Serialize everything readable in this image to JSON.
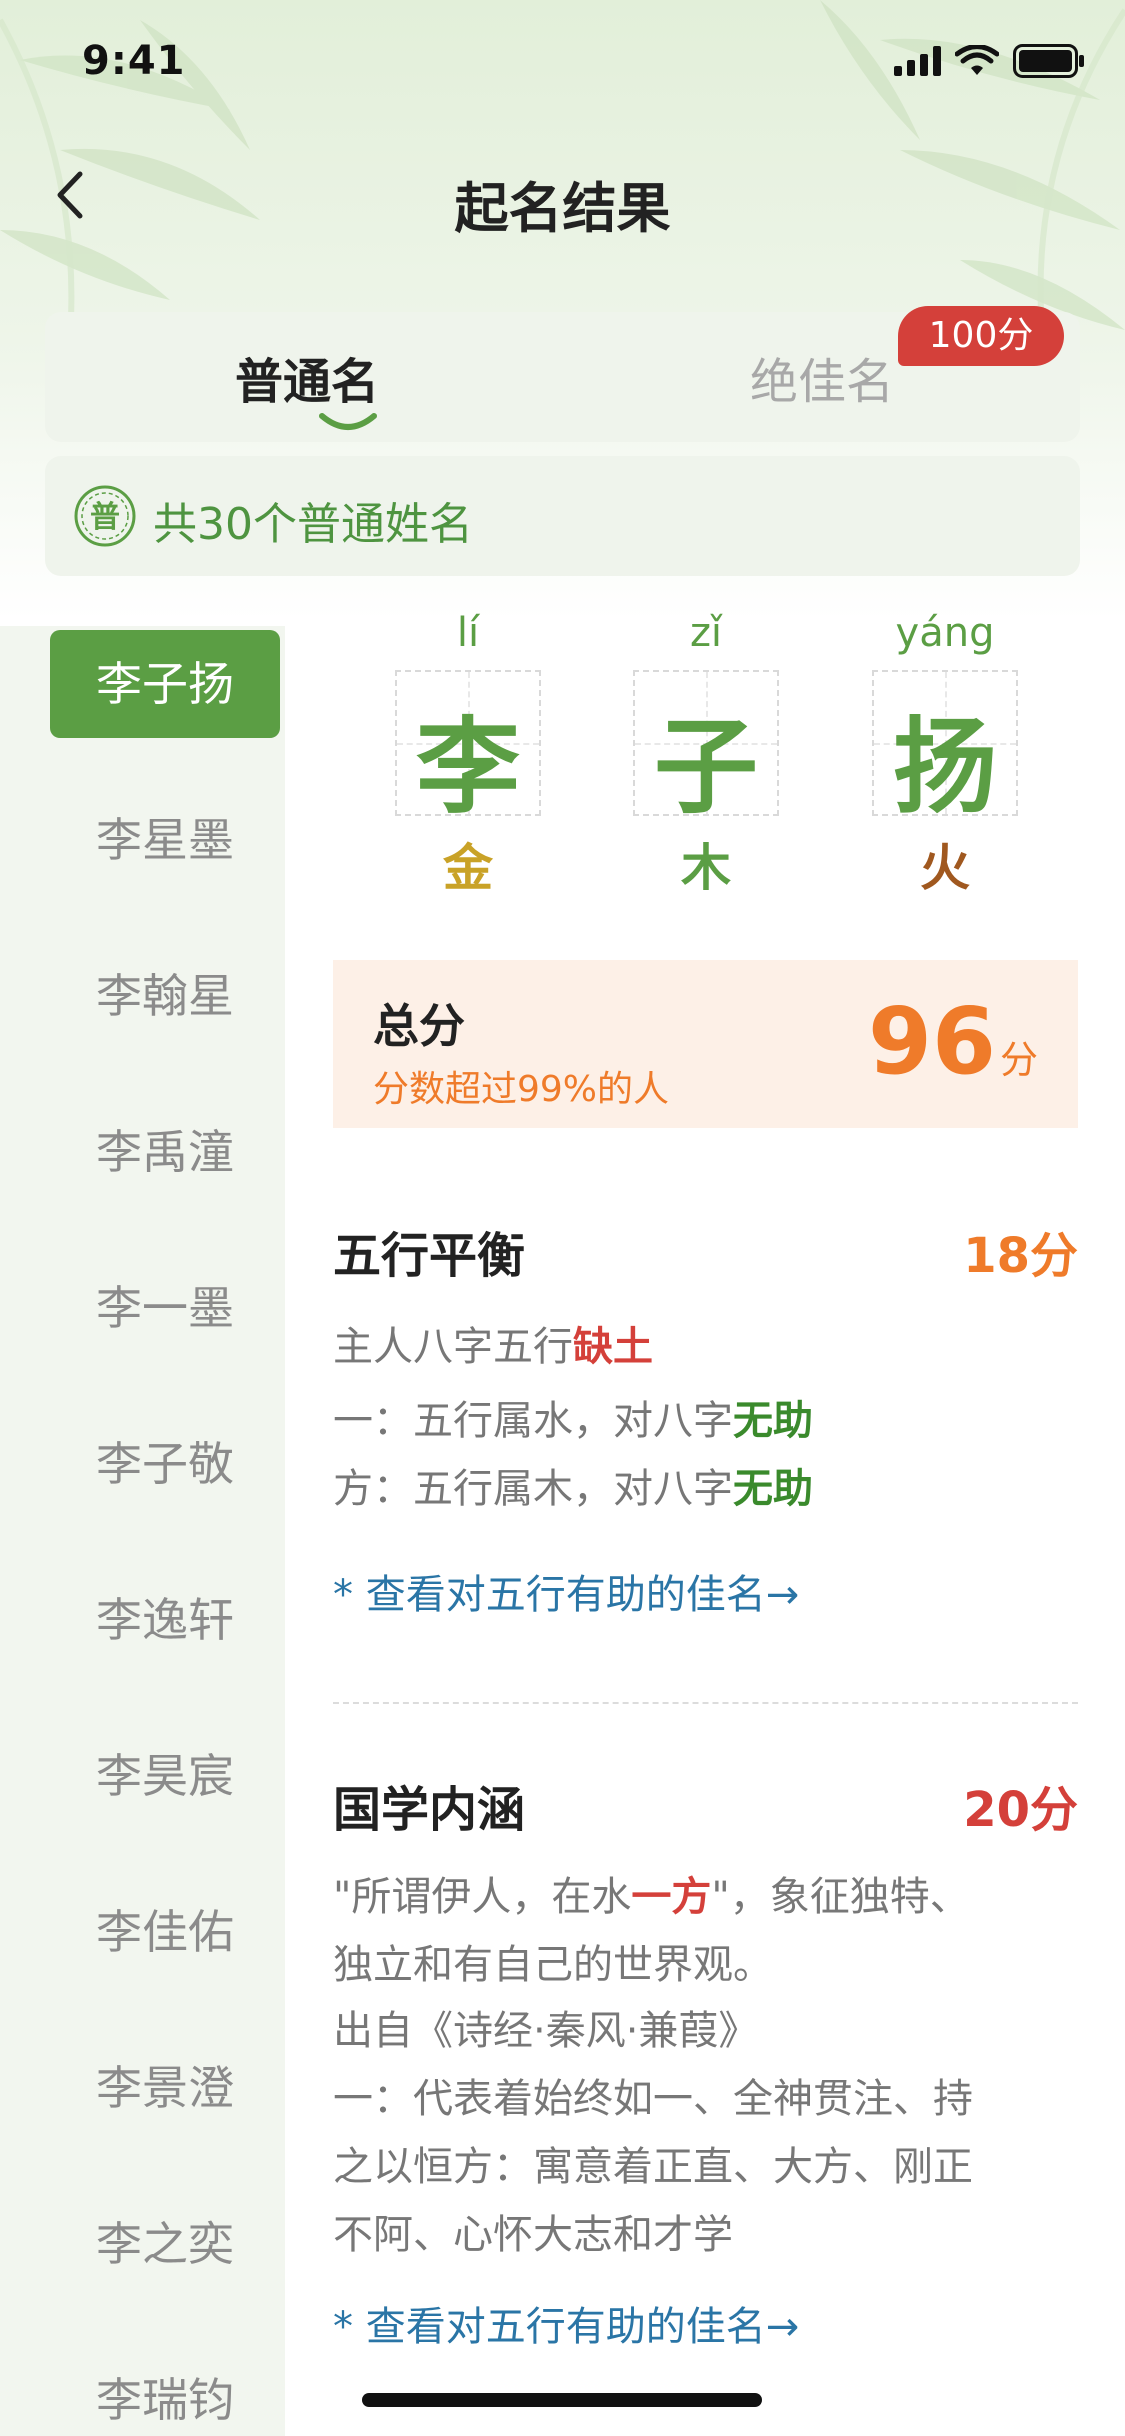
{
  "status_bar": {
    "time": "9:41"
  },
  "nav": {
    "title": "起名结果"
  },
  "tabs": [
    {
      "label": "普通名",
      "active": true
    },
    {
      "label": "绝佳名",
      "active": false,
      "badge": "100分"
    }
  ],
  "count_bar": {
    "icon_char": "普",
    "text": "共30个普通姓名"
  },
  "sidebar": {
    "items": [
      "李子扬",
      "李星墨",
      "李翰星",
      "李禹潼",
      "李一墨",
      "李子敬",
      "李逸轩",
      "李昊宸",
      "李佳佑",
      "李景澄",
      "李之奕",
      "李瑞钧"
    ],
    "active_index": 0
  },
  "name_detail": {
    "chars": [
      {
        "pinyin": "lí",
        "char": "李",
        "element": "金",
        "element_color": "#c9a227"
      },
      {
        "pinyin": "zǐ",
        "char": "子",
        "element": "木",
        "element_color": "#5b9e44"
      },
      {
        "pinyin": "yáng",
        "char": "扬",
        "element": "火",
        "element_color": "#a0581f"
      }
    ],
    "total": {
      "label": "总分",
      "sub": "分数超过99%的人",
      "score": "96",
      "unit": "分"
    }
  },
  "wuxing": {
    "title": "五行平衡",
    "score": "18分",
    "line1_prefix": "主人八字五行",
    "line1_highlight": "缺土",
    "line2_prefix": "一：五行属水，对八字",
    "line2_highlight": "无助",
    "line3_prefix": "方：五行属木，对八字",
    "line3_highlight": "无助",
    "link": "* 查看对五行有助的佳名→"
  },
  "guoxue": {
    "title": "国学内涵",
    "score": "20分",
    "quote_prefix": "\"所谓伊人，在水",
    "quote_highlight": "一方",
    "quote_suffix": "\"，象征独特、",
    "quote_line2": "独立和有自己的世界观。",
    "source": "出自《诗经·秦风·兼葭》",
    "meaning_line1": "一：代表着始终如一、全神贯注、持",
    "meaning_line2": "之以恒方：寓意着正直、大方、刚正",
    "meaning_line3": "不阿、心怀大志和才学",
    "link": "* 查看对五行有助的佳名→"
  },
  "colors": {
    "accent": "#5b9e44",
    "orange": "#ef7b2a",
    "red": "#d4403a",
    "link": "#2a75a6"
  }
}
